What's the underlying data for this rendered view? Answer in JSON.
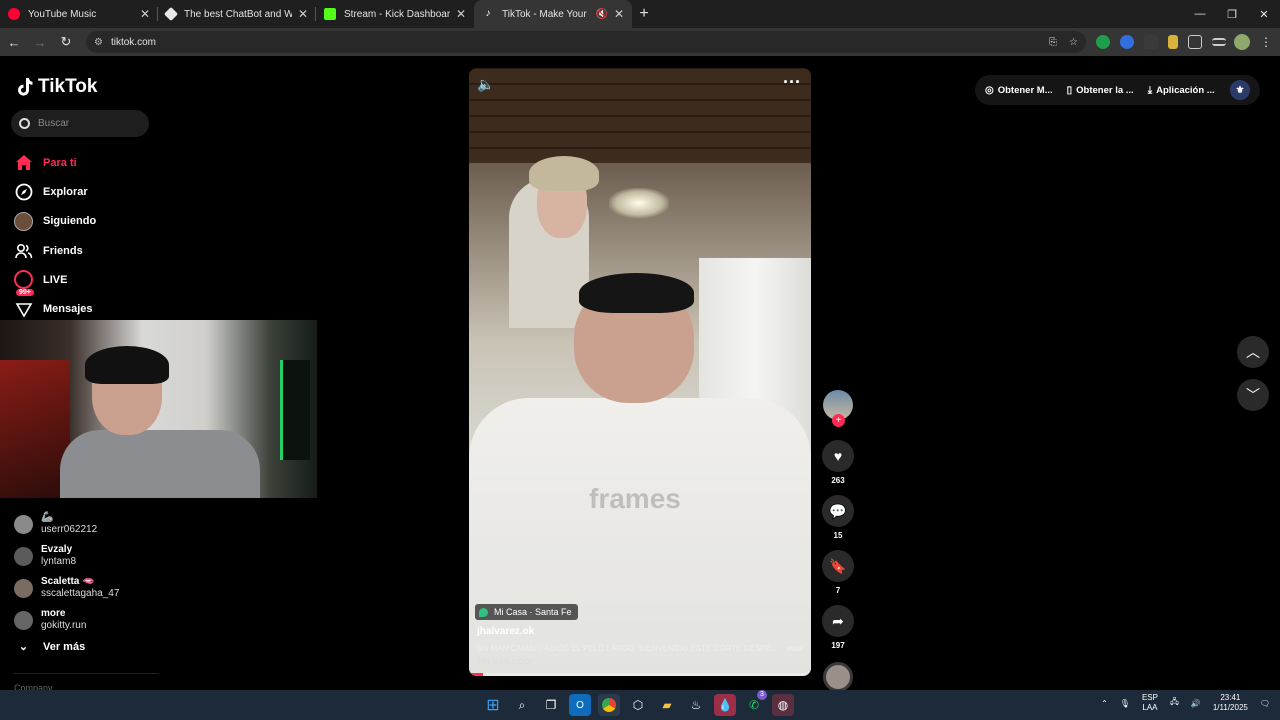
{
  "browser": {
    "tabs": [
      {
        "title": "YouTube Music",
        "favicon_color": "#ff0033",
        "active": false,
        "muted": false
      },
      {
        "title": "The best ChatBot and Widgets",
        "favicon_color": "#e8e8e8",
        "active": false,
        "muted": false
      },
      {
        "title": "Stream - Kick Dashboard",
        "favicon_color": "#53fc18",
        "active": false,
        "muted": false
      },
      {
        "title": "TikTok - Make Your Day",
        "favicon_color": "#ffffff",
        "active": true,
        "muted": true
      }
    ],
    "new_tab": "+",
    "url": "tiktok.com"
  },
  "tiktok": {
    "logo": "TikTok",
    "search_placeholder": "Buscar",
    "nav": [
      {
        "label": "Para ti",
        "icon": "home-icon",
        "active": true
      },
      {
        "label": "Explorar",
        "icon": "compass-icon",
        "active": false
      },
      {
        "label": "Siguiendo",
        "icon": "following-avatar-icon",
        "active": false
      },
      {
        "label": "Friends",
        "icon": "friends-icon",
        "active": false
      },
      {
        "label": "LIVE",
        "icon": "live-icon",
        "active": false
      },
      {
        "label": "Mensajes",
        "icon": "inbox-icon",
        "active": false,
        "badge": "99+"
      }
    ],
    "following": [
      {
        "name": "🦾",
        "user": "userr062212"
      },
      {
        "name": "Evzaly",
        "user": "lyntam8"
      },
      {
        "name": "Scaletta 🫦",
        "user": "sscalettagaha_47"
      },
      {
        "name": "more",
        "user": "gokitty.run"
      }
    ],
    "ver_mas": "Ver más",
    "company": "Company",
    "top_buttons": [
      {
        "label": "Obtener M...",
        "icon": "coins-icon"
      },
      {
        "label": "Obtener la ...",
        "icon": "phone-icon"
      },
      {
        "label": "Aplicación ...",
        "icon": "download-icon"
      }
    ],
    "video": {
      "location": "Mi Casa · Santa Fe",
      "author": "jhalvarez.ok",
      "caption": "UN MAN CAMBIO ADIÓS EL PELO LARGO, BIENVENIDO ESTE CORTE DESPEJAD...",
      "more": "más",
      "translate": "Ver traducción",
      "watermark": "frames",
      "progress": 0.04
    },
    "actions": {
      "likes": "263",
      "comments": "15",
      "saves": "7",
      "shares": "197"
    }
  },
  "taskbar": {
    "lang_top": "ESP",
    "lang_bottom": "LAA",
    "time": "23:41",
    "date": "1/11/2025",
    "whatsapp_badge": "3"
  }
}
